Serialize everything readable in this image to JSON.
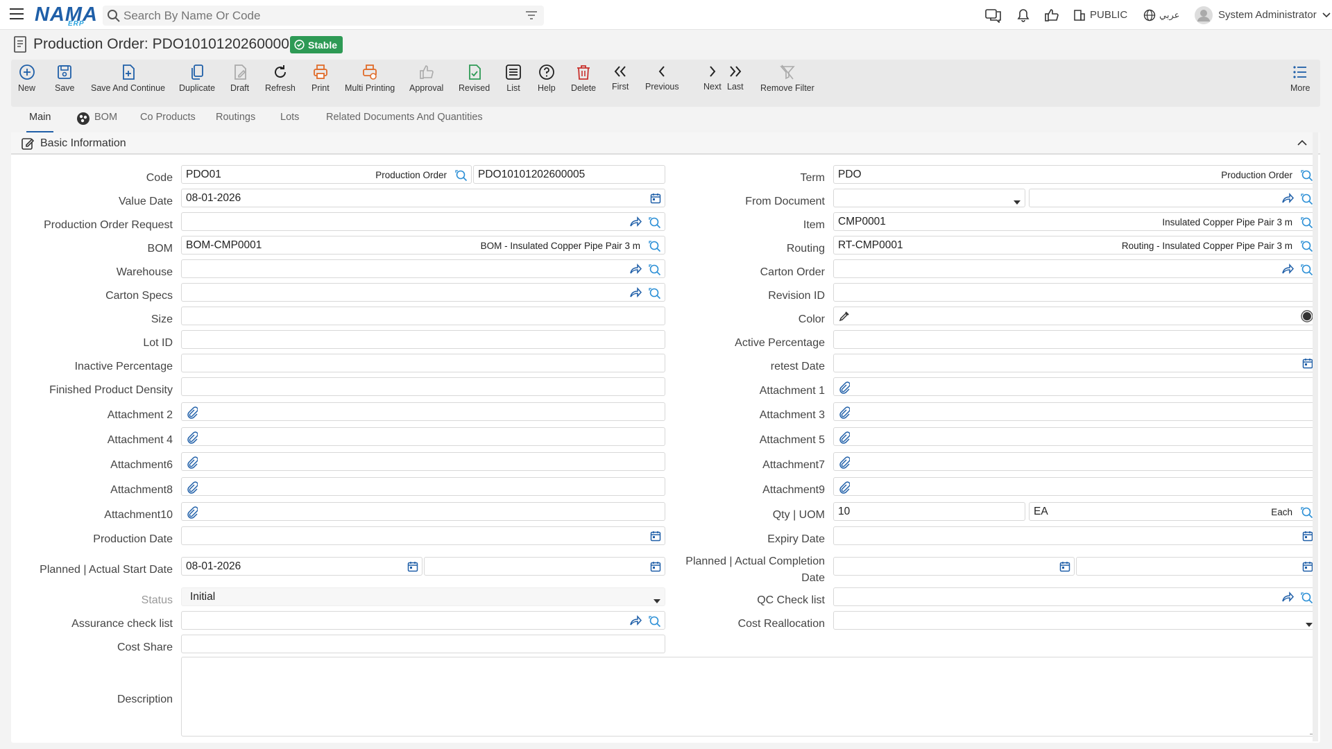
{
  "app": {
    "logo": "NAMA",
    "logo_sub": "ERP",
    "search_placeholder": "Search By Name Or Code",
    "public_label": "PUBLIC",
    "lang_label": "عربي",
    "user": "System Administrator"
  },
  "page": {
    "title": "Production Order: PDO10101202600005",
    "status_badge": "Stable"
  },
  "toolbar": {
    "new": "New",
    "save": "Save",
    "save_continue": "Save And Continue",
    "duplicate": "Duplicate",
    "draft": "Draft",
    "refresh": "Refresh",
    "print": "Print",
    "multi_printing": "Multi Printing",
    "approval": "Approval",
    "revised": "Revised",
    "list": "List",
    "help": "Help",
    "delete": "Delete",
    "first": "First",
    "previous": "Previous",
    "next": "Next",
    "last": "Last",
    "remove_filter": "Remove Filter",
    "more": "More"
  },
  "tabs": {
    "main": "Main",
    "bom": "BOM",
    "co_products": "Co Products",
    "routings": "Routings",
    "lots": "Lots",
    "related": "Related Documents And Quantities"
  },
  "section": {
    "title": "Basic Information"
  },
  "labels": {
    "code": "Code",
    "value_date": "Value Date",
    "por": "Production Order Request",
    "bom": "BOM",
    "warehouse": "Warehouse",
    "carton_specs": "Carton Specs",
    "size": "Size",
    "lot_id": "Lot ID",
    "inactive_pct": "Inactive Percentage",
    "fp_density": "Finished Product Density",
    "att2": "Attachment 2",
    "att4": "Attachment 4",
    "att6": "Attachment6",
    "att8": "Attachment8",
    "att10": "Attachment10",
    "prod_date": "Production Date",
    "pa_start": "Planned | Actual Start Date",
    "status": "Status",
    "assurance": "Assurance check list",
    "cost_share": "Cost Share",
    "description": "Description",
    "term": "Term",
    "from_doc": "From Document",
    "item": "Item",
    "routing": "Routing",
    "carton_order": "Carton Order",
    "revision_id": "Revision ID",
    "color": "Color",
    "active_pct": "Active Percentage",
    "retest": "retest Date",
    "att1": "Attachment 1",
    "att3": "Attachment 3",
    "att5": "Attachment 5",
    "att7": "Attachment7",
    "att9": "Attachment9",
    "qty_uom": "Qty | UOM",
    "expiry": "Expiry Date",
    "pa_completion_1": "Planned | Actual Completion",
    "pa_completion_2": "Date",
    "qc": "QC Check list",
    "cost_realloc": "Cost Reallocation"
  },
  "values": {
    "code": "PDO01",
    "code_hint": "Production Order",
    "doc_no": "PDO10101202600005",
    "value_date": "08-01-2026",
    "bom": "BOM-CMP0001",
    "bom_hint": "BOM - Insulated Copper Pipe Pair 3 m",
    "pa_start": "08-01-2026",
    "status": "Initial",
    "term": "PDO",
    "term_hint": "Production Order",
    "item": "CMP0001",
    "item_hint": "Insulated Copper Pipe Pair 3 m",
    "routing": "RT-CMP0001",
    "routing_hint": "Routing - Insulated Copper Pipe Pair 3 m",
    "qty": "10",
    "uom": "EA",
    "uom_hint": "Each"
  }
}
